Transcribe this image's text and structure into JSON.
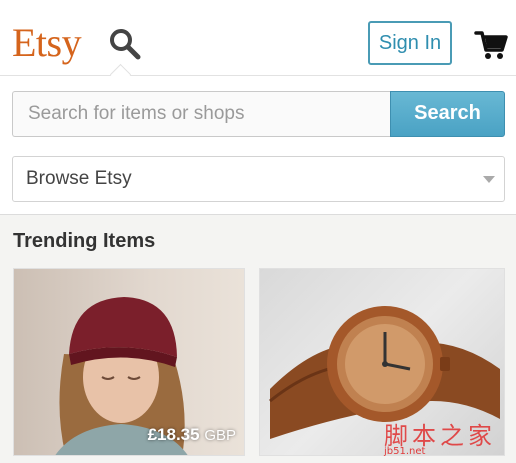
{
  "header": {
    "logo": "Etsy",
    "search_icon": "search-icon",
    "signin_label": "Sign In",
    "cart_icon": "cart-icon"
  },
  "search": {
    "placeholder": "Search for items or shops",
    "value": "",
    "button_label": "Search"
  },
  "browse": {
    "selected": "Browse Etsy"
  },
  "trending": {
    "title": "Trending Items",
    "items": [
      {
        "image": "woman-in-red-beanie",
        "price": "£18.35",
        "currency": "GBP"
      },
      {
        "image": "wooden-wristwatch",
        "price": "",
        "currency": ""
      }
    ]
  },
  "watermark": {
    "text": "脚本之家",
    "sub": "jb51.net"
  },
  "colors": {
    "brand": "#d5641c",
    "accent": "#4aa2c4",
    "background": "#f4f4f2"
  }
}
